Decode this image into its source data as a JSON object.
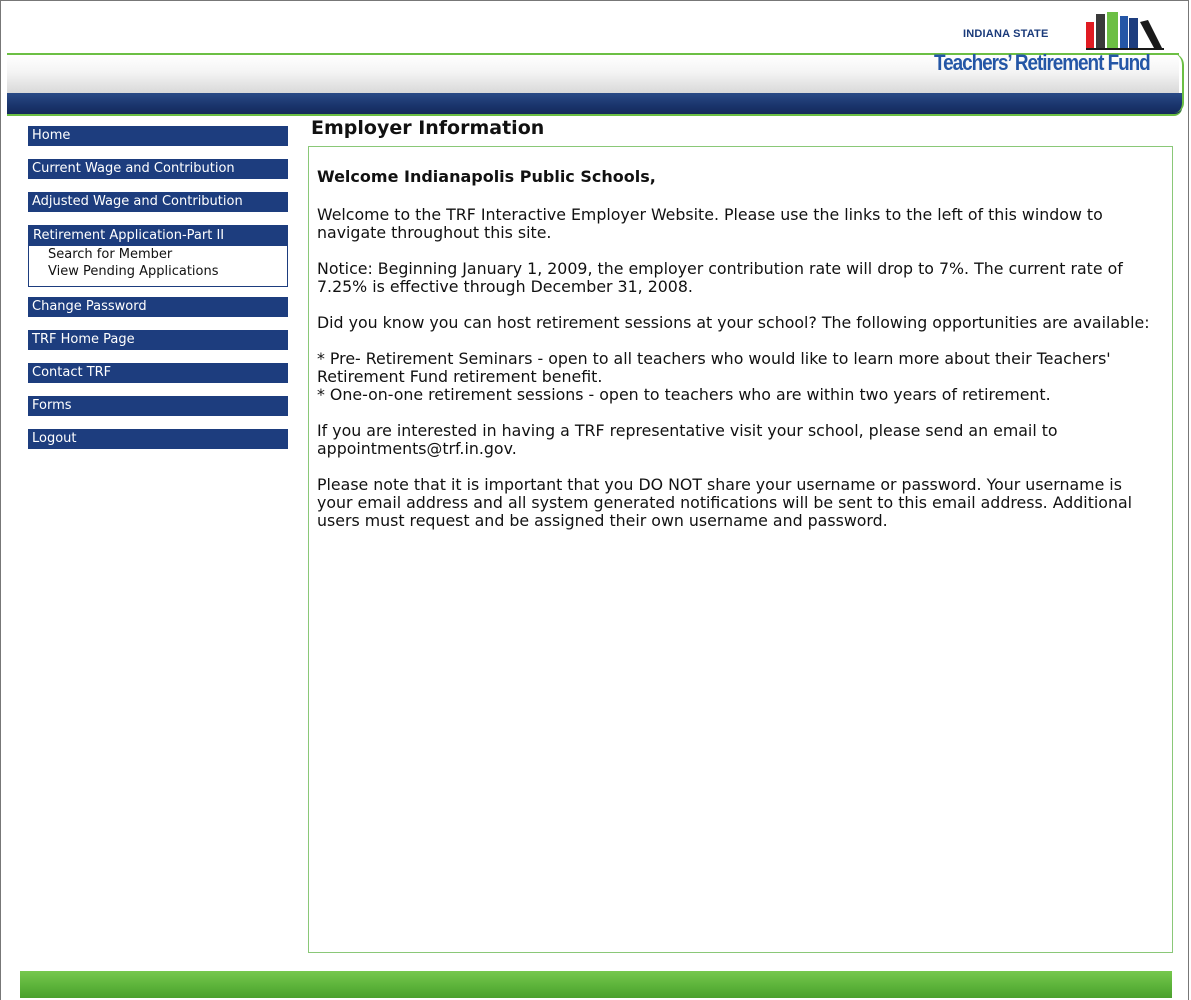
{
  "brand": {
    "state_label": "INDIANA STATE",
    "name": "Teachers’ Retirement Fund",
    "colors": {
      "navy": "#1d3d7e",
      "green": "#5cb33a",
      "logo_blue": "#2456a6"
    }
  },
  "sidebar": {
    "items": [
      {
        "label": "Home"
      },
      {
        "label": "Current Wage and Contribution"
      },
      {
        "label": "Adjusted Wage and Contribution"
      },
      {
        "label": "Retirement Application-Part II",
        "sub_items": [
          "Search for Member",
          "View Pending Applications"
        ]
      },
      {
        "label": "Change Password"
      },
      {
        "label": "TRF Home Page"
      },
      {
        "label": "Contact TRF"
      },
      {
        "label": "Forms"
      },
      {
        "label": "Logout"
      }
    ]
  },
  "main": {
    "title": "Employer Information",
    "welcome": "Welcome Indianapolis Public Schools,",
    "paragraphs": {
      "intro": "Welcome to the TRF Interactive Employer Website. Please use the links to the left of this window to navigate throughout this site.",
      "notice": "Notice: Beginning January 1, 2009, the employer contribution rate will drop to 7%. The current rate of 7.25% is effective through December 31, 2008.",
      "sessions": "Did you know you can host retirement sessions at your school? The following opportunities are available:",
      "bullet_1": "* Pre- Retirement Seminars - open to all teachers who would like to learn more about their Teachers' Retirement Fund retirement benefit.",
      "bullet_2": "* One-on-one retirement sessions - open to teachers who are within two years of retirement.",
      "representative": "If you are interested in having a TRF representative visit your school, please send an email to appointments@trf.in.gov.",
      "security": "Please note that it is important that you DO NOT share your username or password. Your username is your email address and all system generated notifications will be sent to this email address. Additional users must request and be assigned their own username and password."
    }
  }
}
